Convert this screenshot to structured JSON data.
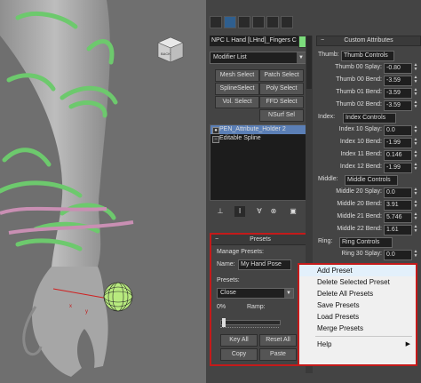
{
  "viewport": {
    "label_box": "BACK",
    "label_x": "x",
    "label_y": "y"
  },
  "command_panel": {
    "tabs": [
      "create-icon",
      "modify-icon",
      "hierarchy-icon",
      "motion-icon",
      "display-icon",
      "utilities-icon"
    ],
    "object_name": "NPC L Hand [LHnd]_Fingers C",
    "object_color": "#7cdc7c",
    "modifier_list": "Modifier List",
    "modifier_buttons": [
      [
        "Mesh Select",
        "Patch Select"
      ],
      [
        "SplineSelect",
        "Poly Select"
      ],
      [
        "Vol. Select",
        "FFD Select"
      ],
      [
        "",
        "NSurf Sel"
      ]
    ],
    "stack": [
      {
        "label": "PEN_Attribute_Holder 2",
        "selected": true,
        "mark": "●"
      },
      {
        "label": "Editable Spline",
        "selected": false,
        "mark": "−"
      }
    ]
  },
  "presets_rollout": {
    "title": "Presets",
    "manage_label": "Manage Presets:",
    "name_label": "Name:",
    "name_value": "My Hand Pose",
    "presets_label": "Presets:",
    "presets_value": "Close",
    "percent_label": "0%",
    "ramp_label": "Ramp:",
    "key_all": "Key All",
    "reset_all": "Reset All",
    "copy": "Copy",
    "paste": "Paste"
  },
  "custom_attributes": {
    "title": "Custom Attributes",
    "thumb_label": "Thumb:",
    "thumb_controls": "Thumb Controls",
    "index_label": "Index:",
    "index_controls": "Index Controls",
    "middle_label": "Middle:",
    "middle_controls": "Middle Controls",
    "ring_label": "Ring:",
    "ring_controls": "Ring Controls",
    "thumb_rows": [
      {
        "label": "Thumb 00 Splay:",
        "value": "-0.80"
      },
      {
        "label": "Thumb 00 Bend:",
        "value": "-3.59"
      },
      {
        "label": "Thumb 01 Bend:",
        "value": "-3.59"
      },
      {
        "label": "Thumb 02 Bend:",
        "value": "-3.59"
      },
      {
        "label": "Thumb 30 Bend:",
        "value": "0.68"
      }
    ],
    "index_rows": [
      {
        "label": "Index 10 Splay:",
        "value": "0.0"
      },
      {
        "label": "Index 10 Bend:",
        "value": "-1.99"
      },
      {
        "label": "Index 11 Bend:",
        "value": "0.146"
      },
      {
        "label": "Index 12 Bend:",
        "value": "-1.99"
      }
    ],
    "middle_rows": [
      {
        "label": "Middle 20 Splay:",
        "value": "0.0"
      },
      {
        "label": "Middle 20 Bend:",
        "value": "3.91"
      },
      {
        "label": "Middle 21 Bend:",
        "value": "5.746"
      },
      {
        "label": "Middle 22 Bend:",
        "value": "1.61"
      }
    ],
    "ring_rows": [
      {
        "label": "Ring 30 Splay:",
        "value": "0.0"
      }
    ]
  },
  "context_menu": {
    "items": [
      {
        "label": "Add Preset",
        "highlight": true
      },
      {
        "label": "Delete Selected Preset"
      },
      {
        "label": "Delete All Presets"
      },
      {
        "label": "Save Presets"
      },
      {
        "label": "Load Presets"
      },
      {
        "label": "Merge Presets"
      }
    ],
    "help": "Help",
    "help_sub": "▶"
  }
}
